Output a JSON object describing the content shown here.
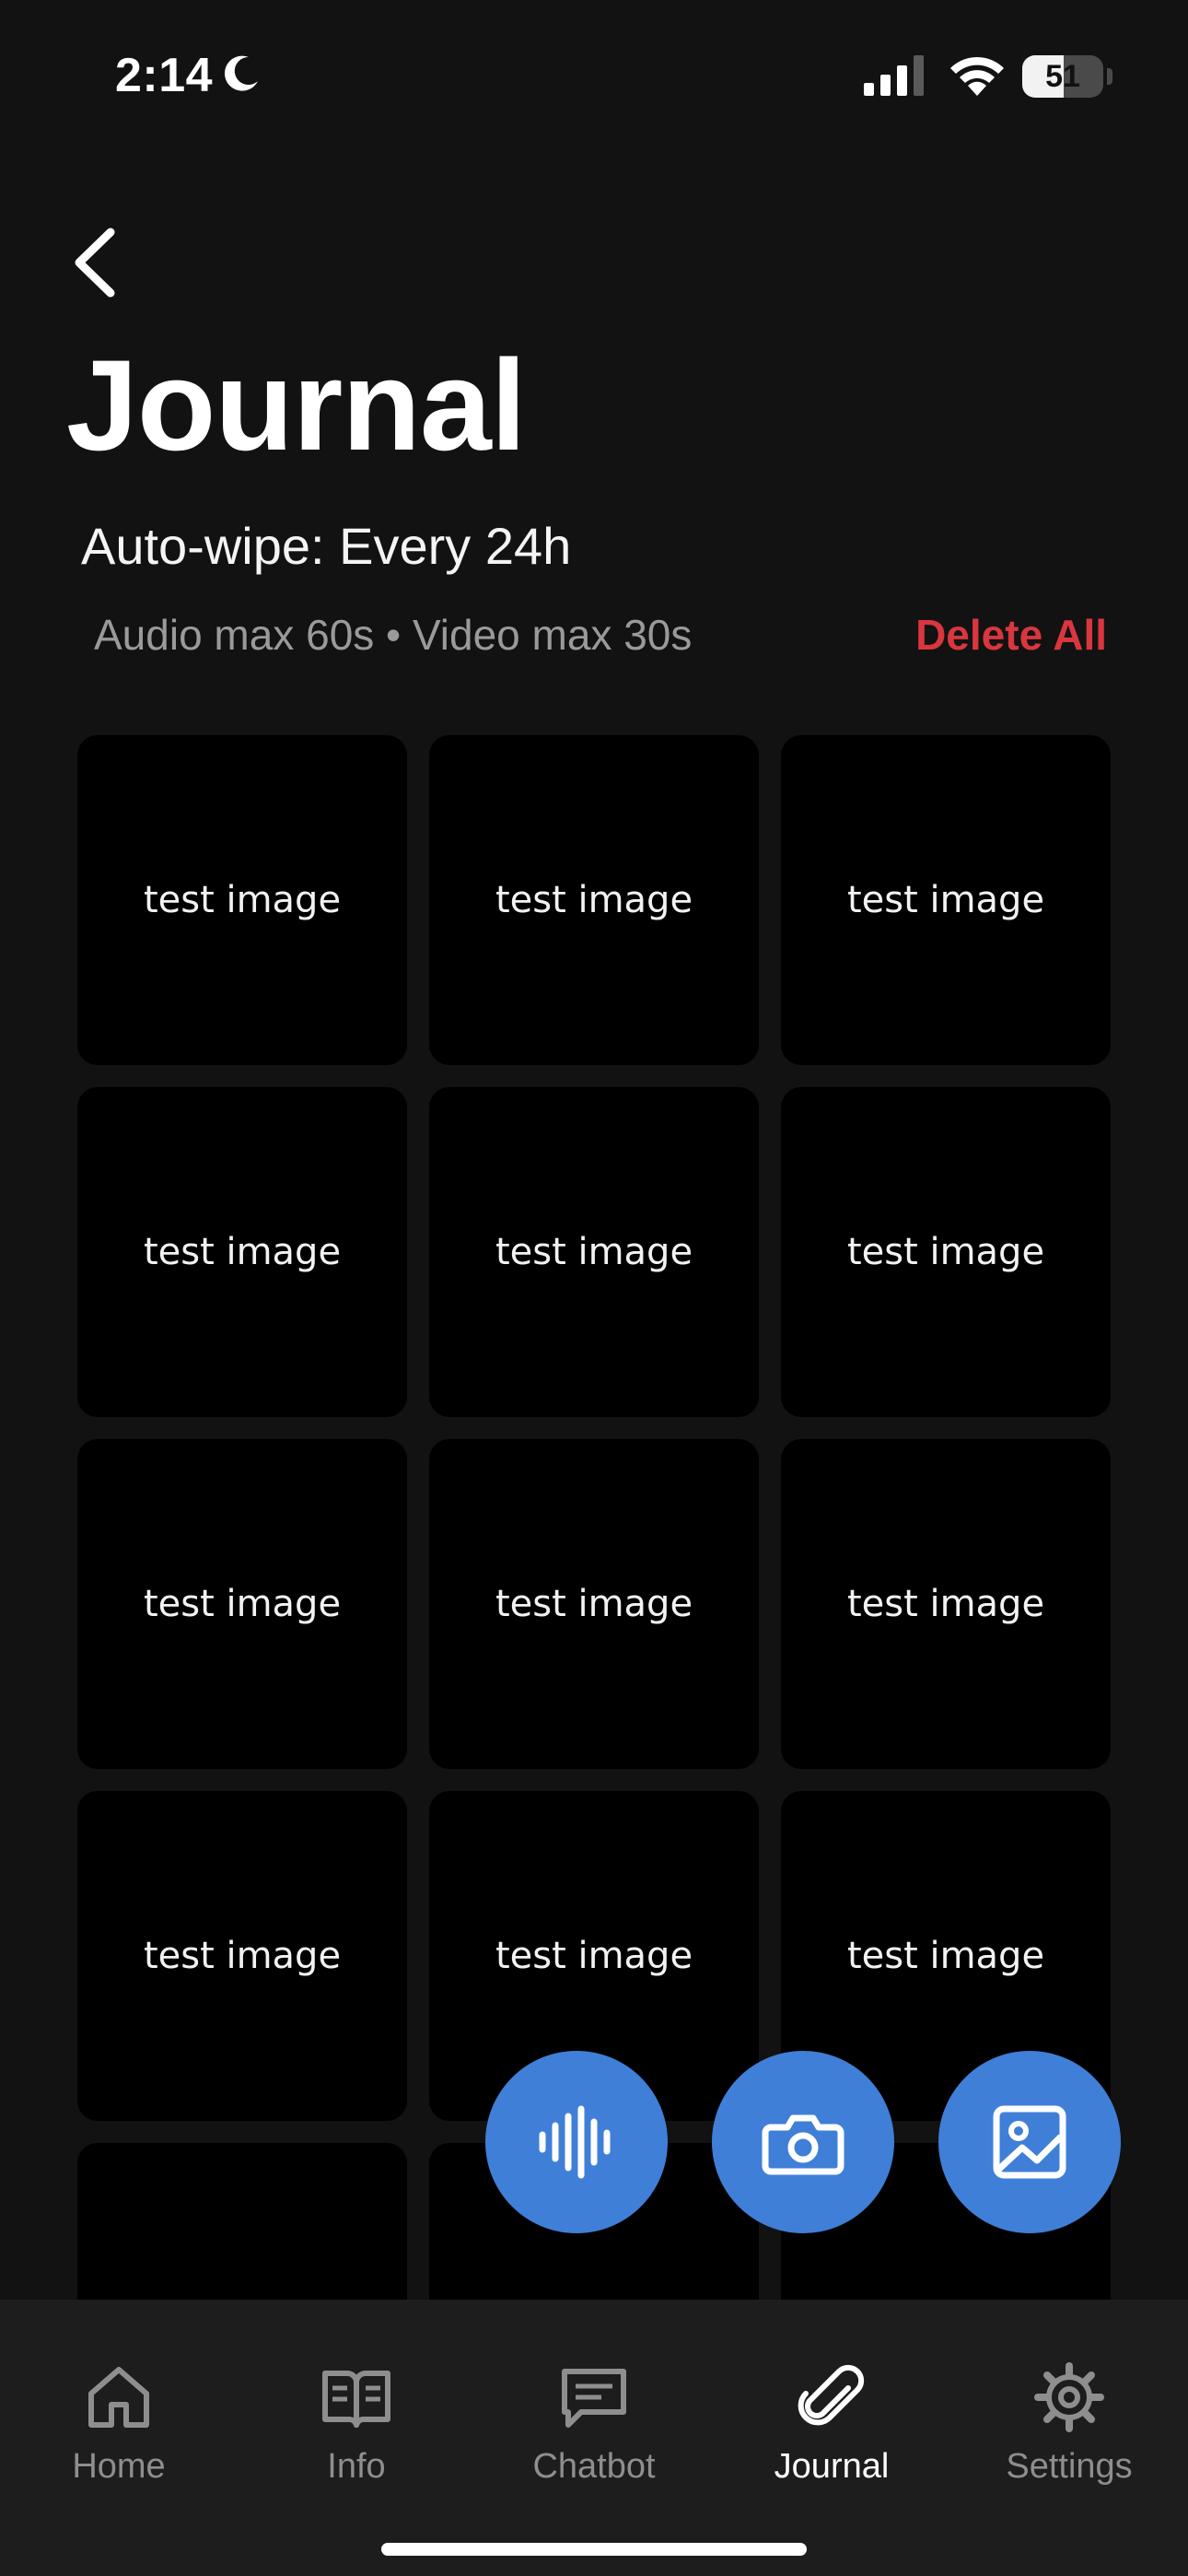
{
  "status_bar": {
    "time": "2:14",
    "battery": "51"
  },
  "header": {
    "title": "Journal",
    "auto_wipe": "Auto-wipe: Every 24h",
    "limits": "Audio max 60s • Video max 30s",
    "delete_all": "Delete All"
  },
  "grid": {
    "items": [
      {
        "label": "test image"
      },
      {
        "label": "test image"
      },
      {
        "label": "test image"
      },
      {
        "label": "test image"
      },
      {
        "label": "test image"
      },
      {
        "label": "test image"
      },
      {
        "label": "test image"
      },
      {
        "label": "test image"
      },
      {
        "label": "test image"
      },
      {
        "label": "test image"
      },
      {
        "label": "test image"
      },
      {
        "label": "test image"
      },
      {
        "label": ""
      },
      {
        "label": ""
      },
      {
        "label": ""
      }
    ]
  },
  "actions": {
    "icons": [
      "audio-waveform-icon",
      "camera-icon",
      "image-icon"
    ]
  },
  "tabs": [
    {
      "label": "Home",
      "icon": "home-icon"
    },
    {
      "label": "Info",
      "icon": "book-icon"
    },
    {
      "label": "Chatbot",
      "icon": "chat-icon"
    },
    {
      "label": "Journal",
      "icon": "paperclip-icon",
      "active": true
    },
    {
      "label": "Settings",
      "icon": "gear-icon"
    }
  ],
  "colors": {
    "background": "#121212",
    "accent": "#3f7fd7",
    "danger": "#d9363e",
    "tab_bar": "#1d1d1d"
  }
}
